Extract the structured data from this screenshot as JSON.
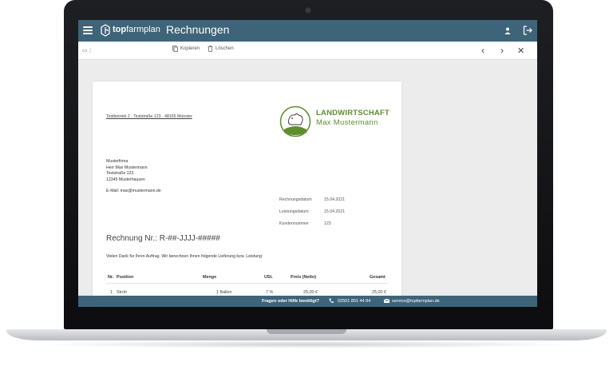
{
  "app": {
    "brand_bold": "top",
    "brand_rest": "farmplan",
    "page_title": "Rechnungen"
  },
  "toolbar": {
    "copy_label": "Kopieren",
    "delete_label": "Löschen"
  },
  "invoice": {
    "sender_line": "Testbetrieb 2 · Teststraße 123 · 48165 Münster",
    "recipient": {
      "company": "Musterfirma",
      "name": "Herr Max Mustermann",
      "street": "Teststraße 123",
      "city": "12345 Musterhausen"
    },
    "email_line": "E-Mail: max@mustermann.de",
    "company_name_1": "LANDWIRTSCHAFT",
    "company_name_2": "Max Mustermann",
    "meta": [
      {
        "label": "Rechnungsdatum",
        "value": "15.04.2021"
      },
      {
        "label": "Leistungsdatum",
        "value": "15.04.2021"
      },
      {
        "label": "Kundennummer",
        "value": "123"
      }
    ],
    "title": "Rechnung Nr.: R-##-JJJJ-#####",
    "intro": "Vielen Dank für Ihren Auftrag. Wir berechnen Ihnen folgende Lieferung bzw. Leistung:",
    "table": {
      "headers": [
        "Nr.",
        "Position",
        "Menge",
        "USt.",
        "Preis (Netto)",
        "Gesamt"
      ],
      "rows": [
        [
          "1",
          "Stroh",
          "1 Ballen",
          "7 %",
          "25,00 €",
          "25,00 €"
        ]
      ]
    }
  },
  "footer": {
    "help_text": "Fragen oder Hilfe benötigt?",
    "phone": "02501 801 44 84",
    "email": "service@topfarmplan.de"
  },
  "colors": {
    "header_bg": "#3e6479",
    "brand_green": "#5f8d2e"
  },
  "icons": [
    "hamburger-icon",
    "logo-icon",
    "user-icon",
    "logout-icon",
    "sidebar-toggle-icon",
    "copy-icon",
    "trash-icon",
    "chevron-left-icon",
    "chevron-right-icon",
    "close-icon",
    "phone-icon",
    "mail-icon"
  ]
}
